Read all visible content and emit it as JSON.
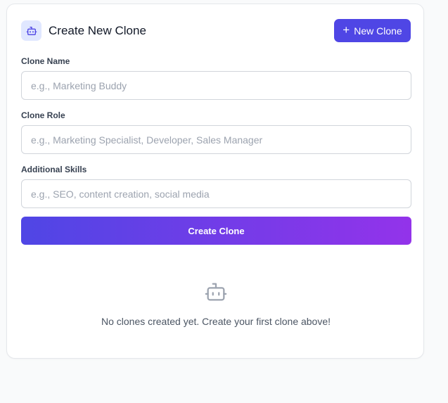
{
  "header": {
    "title": "Create New Clone",
    "icon": "robot-icon",
    "new_button_label": "New Clone",
    "new_button_icon": "plus-icon"
  },
  "form": {
    "name": {
      "label": "Clone Name",
      "value": "",
      "placeholder": "e.g., Marketing Buddy"
    },
    "role": {
      "label": "Clone Role",
      "value": "",
      "placeholder": "e.g., Marketing Specialist, Developer, Sales Manager"
    },
    "skills": {
      "label": "Additional Skills",
      "value": "",
      "placeholder": "e.g., SEO, content creation, social media"
    },
    "submit_label": "Create Clone"
  },
  "empty_state": {
    "icon": "robot-icon",
    "message": "No clones created yet. Create your first clone above!"
  },
  "colors": {
    "accent": "#4f46e5",
    "gradient_end": "#9333ea",
    "badge_bg": "#e0e7ff"
  }
}
